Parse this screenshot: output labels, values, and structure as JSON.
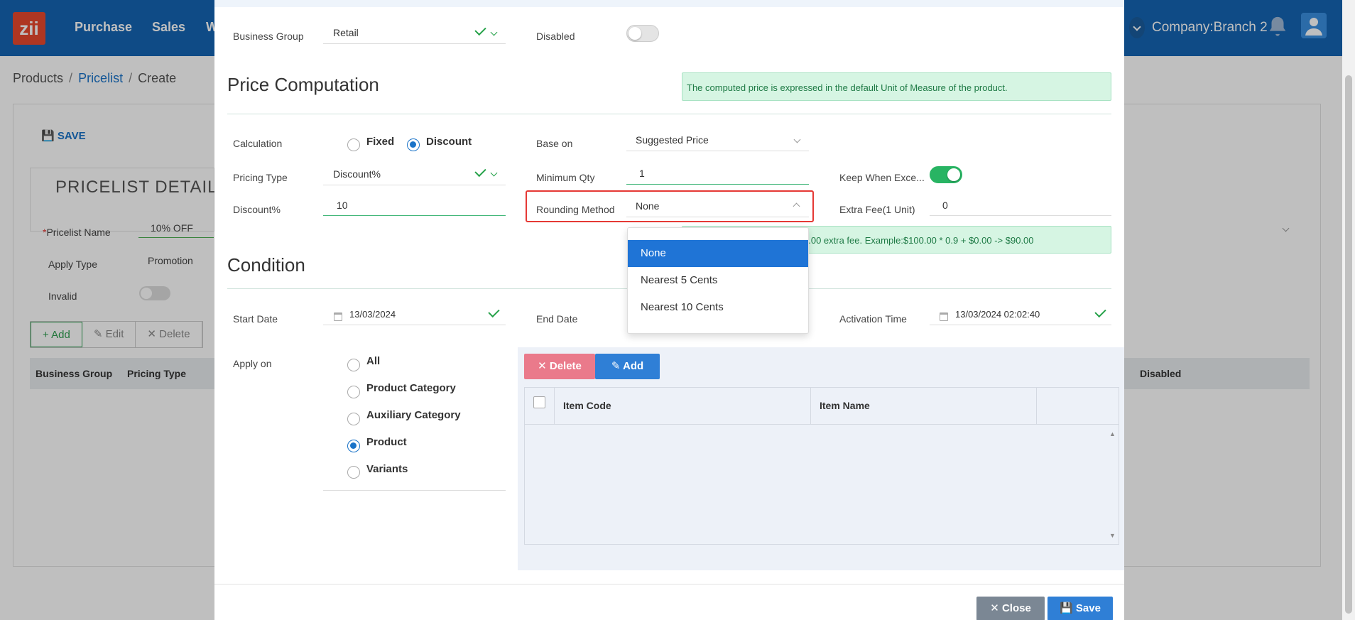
{
  "app": {
    "logo_text": "zii",
    "nav": [
      "Purchase",
      "Sales",
      "W"
    ],
    "company": "Company:Branch 2"
  },
  "breadcrumb": [
    "Products",
    "Pricelist",
    "Create"
  ],
  "background_page": {
    "save_label": "SAVE",
    "detail_title": "PRICELIST DETAIL",
    "pricelist_name_label": "Pricelist Name",
    "pricelist_name_value": "10% OFF",
    "apply_type_label": "Apply Type",
    "apply_type_value": "Promotion",
    "invalid_label": "Invalid",
    "buttons": {
      "add": "Add",
      "edit": "Edit",
      "delete": "Delete"
    },
    "columns": [
      "Business Group",
      "Pricing Type",
      "Disabled"
    ]
  },
  "modal": {
    "business_group_label": "Business Group",
    "business_group_value": "Retail",
    "disabled_label": "Disabled",
    "price_section_title": "Price Computation",
    "price_info": "The computed price is expressed in the default Unit of Measure of the product.",
    "calculation_label": "Calculation",
    "calc_options": [
      "Fixed",
      "Discount"
    ],
    "calc_selected": "Discount",
    "base_on_label": "Base on",
    "base_on_value": "Suggested Price",
    "pricing_type_label": "Pricing Type",
    "pricing_type_value": "Discount%",
    "min_qty_label": "Minimum Qty",
    "min_qty_value": "1",
    "keep_label": "Keep When Exce...",
    "discount_label": "Discount%",
    "discount_value": "10",
    "rounding_label": "Rounding Method",
    "rounding_value": "None",
    "extra_fee_label": "Extra Fee(1 Unit)",
    "extra_fee_value": "0",
    "example_info": "0.00 extra fee. Example:$100.00 * 0.9 + $0.00 -> $90.00",
    "rounding_options": [
      "None",
      "Nearest 5 Cents",
      "Nearest 10 Cents"
    ],
    "rounding_selected_index": 0,
    "condition_title": "Condition",
    "start_date_label": "Start Date",
    "start_date_value": "13/03/2024",
    "end_date_label": "End Date",
    "activation_label": "Activation Time",
    "activation_value": "13/03/2024 02:02:40",
    "apply_on_label": "Apply on",
    "apply_on_options": [
      "All",
      "Product Category",
      "Auxiliary Category",
      "Product",
      "Variants"
    ],
    "apply_on_selected": "Product",
    "delete_label": "Delete",
    "add_label": "Add",
    "grid_columns": [
      "Item Code",
      "Item Name"
    ],
    "close_label": "Close",
    "save_label": "Save"
  },
  "colors": {
    "topbar": "#1565b3",
    "primary": "#2f7fd6",
    "success": "#28b463",
    "danger_highlight": "#e53935"
  }
}
